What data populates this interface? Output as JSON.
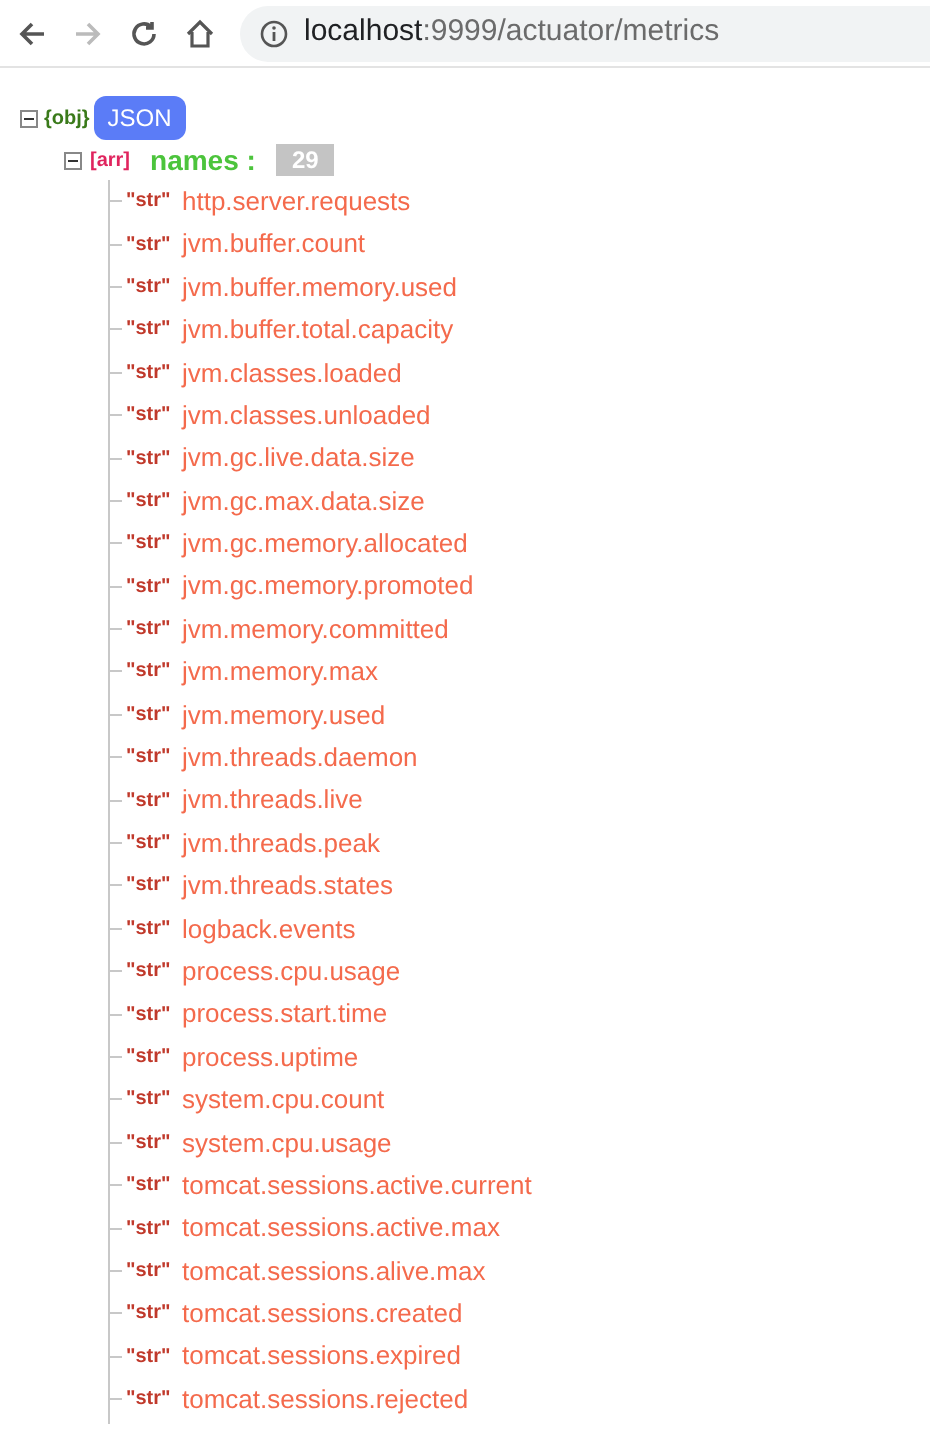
{
  "browser": {
    "url_host": "localhost",
    "url_rest": ":9999/actuator/metrics"
  },
  "root": {
    "type_label": "{obj}",
    "name": "JSON",
    "expanded": true,
    "children": [
      {
        "type_label": "[arr]",
        "key": "names :",
        "count": "29",
        "expanded": true,
        "items": [
          {
            "type_label": "\"str\"",
            "value": "http.server.requests"
          },
          {
            "type_label": "\"str\"",
            "value": "jvm.buffer.count"
          },
          {
            "type_label": "\"str\"",
            "value": "jvm.buffer.memory.used"
          },
          {
            "type_label": "\"str\"",
            "value": "jvm.buffer.total.capacity"
          },
          {
            "type_label": "\"str\"",
            "value": "jvm.classes.loaded"
          },
          {
            "type_label": "\"str\"",
            "value": "jvm.classes.unloaded"
          },
          {
            "type_label": "\"str\"",
            "value": "jvm.gc.live.data.size"
          },
          {
            "type_label": "\"str\"",
            "value": "jvm.gc.max.data.size"
          },
          {
            "type_label": "\"str\"",
            "value": "jvm.gc.memory.allocated"
          },
          {
            "type_label": "\"str\"",
            "value": "jvm.gc.memory.promoted"
          },
          {
            "type_label": "\"str\"",
            "value": "jvm.memory.committed"
          },
          {
            "type_label": "\"str\"",
            "value": "jvm.memory.max"
          },
          {
            "type_label": "\"str\"",
            "value": "jvm.memory.used"
          },
          {
            "type_label": "\"str\"",
            "value": "jvm.threads.daemon"
          },
          {
            "type_label": "\"str\"",
            "value": "jvm.threads.live"
          },
          {
            "type_label": "\"str\"",
            "value": "jvm.threads.peak"
          },
          {
            "type_label": "\"str\"",
            "value": "jvm.threads.states"
          },
          {
            "type_label": "\"str\"",
            "value": "logback.events"
          },
          {
            "type_label": "\"str\"",
            "value": "process.cpu.usage"
          },
          {
            "type_label": "\"str\"",
            "value": "process.start.time"
          },
          {
            "type_label": "\"str\"",
            "value": "process.uptime"
          },
          {
            "type_label": "\"str\"",
            "value": "system.cpu.count"
          },
          {
            "type_label": "\"str\"",
            "value": "system.cpu.usage"
          },
          {
            "type_label": "\"str\"",
            "value": "tomcat.sessions.active.current"
          },
          {
            "type_label": "\"str\"",
            "value": "tomcat.sessions.active.max"
          },
          {
            "type_label": "\"str\"",
            "value": "tomcat.sessions.alive.max"
          },
          {
            "type_label": "\"str\"",
            "value": "tomcat.sessions.created"
          },
          {
            "type_label": "\"str\"",
            "value": "tomcat.sessions.expired"
          },
          {
            "type_label": "\"str\"",
            "value": "tomcat.sessions.rejected"
          }
        ]
      }
    ]
  }
}
